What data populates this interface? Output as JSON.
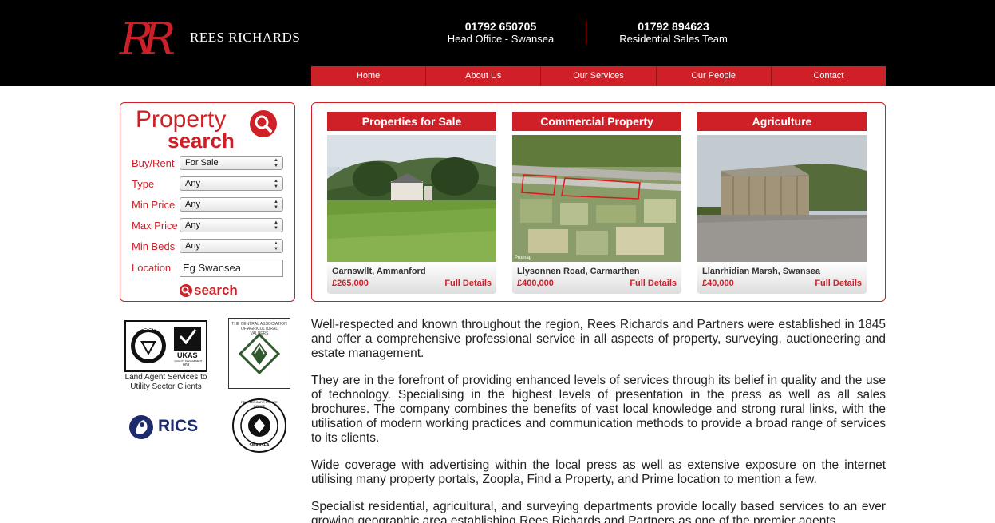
{
  "brand": {
    "monogram": "RR",
    "name": "REES RICHARDS"
  },
  "header": {
    "contacts": [
      {
        "number": "01792 650705",
        "label": "Head Office - Swansea"
      },
      {
        "number": "01792 894623",
        "label": "Residential Sales Team"
      }
    ]
  },
  "nav": {
    "items": [
      "Home",
      "About Us",
      "Our Services",
      "Our People",
      "Contact"
    ]
  },
  "search": {
    "title_line1": "Property",
    "title_line2": "search",
    "fields": [
      {
        "label": "Buy/Rent",
        "value": "For Sale"
      },
      {
        "label": "Type",
        "value": "Any"
      },
      {
        "label": "Min Price",
        "value": "Any"
      },
      {
        "label": "Max Price",
        "value": "Any"
      },
      {
        "label": "Min Beds",
        "value": "Any"
      }
    ],
    "location_label": "Location",
    "location_value": "Eg Swansea",
    "button_label": "search"
  },
  "featured": [
    {
      "heading": "Properties for Sale",
      "location": "Garnswllt, Ammanford",
      "price": "£265,000",
      "link": "Full Details"
    },
    {
      "heading": "Commercial Property",
      "location": "Llysonnen Road, Carmarthen",
      "price": "£400,000",
      "link": "Full Details",
      "watermark": "Promap"
    },
    {
      "heading": "Agriculture",
      "location": "Llanrhidian Marsh, Swansea",
      "price": "£40,000",
      "link": "Full Details"
    }
  ],
  "accreditations": {
    "bsi": {
      "top": "BSI",
      "badge": "UKAS",
      "sub": "QUALITY MANAGEMENT",
      "code": "003",
      "caption": "Land Agent Services to Utility Sector Clients"
    },
    "cav": "THE CENTRAL ASSOCIATION OF AGRICULTURAL VALUERS",
    "rics": "RICS",
    "penllergare": {
      "top": "PENLLERGARE ESTATE OFFICE",
      "bottom": "SWANSEA"
    }
  },
  "intro": {
    "paragraphs": [
      "Well-respected and known throughout the region, Rees Richards and Partners were established in 1845 and offer a comprehensive professional service in all aspects of property, surveying, auctioneering and estate management.",
      "They are in the forefront of providing enhanced levels of services through its belief in quality and the use of technology. Specialising in the highest levels of presentation in the press as well as all sales brochures. The company combines the benefits of vast local knowledge and strong rural links, with the utilisation of modern working practices and communication methods to provide a broad range of services to its clients.",
      "Wide coverage with advertising within the local press as well as extensive exposure on the internet utilising many property portals, Zoopla, Find a Property, and Prime location to mention a few.",
      "Specialist residential, agricultural, and surveying departments provide locally based services to an ever growing geographic area establishing Rees Richards and Partners as one of the premier agents"
    ]
  },
  "colors": {
    "accent": "#cf1f27",
    "header_bg": "#000000",
    "rics_blue": "#1d2a6b"
  }
}
